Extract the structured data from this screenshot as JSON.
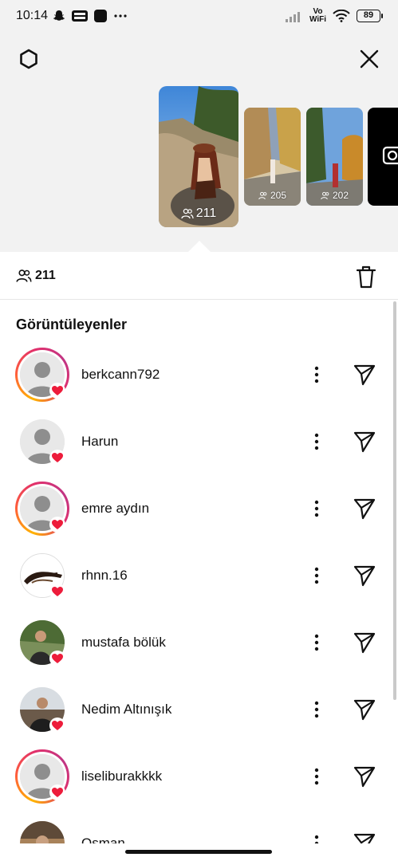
{
  "status_bar": {
    "time": "10:14",
    "left_icons": [
      "snapchat-icon",
      "temu-icon",
      "app-icon",
      "more-dots-icon"
    ],
    "vowifi_top": "Vo",
    "vowifi_bottom": "WiFi",
    "battery": "89"
  },
  "header": {
    "settings_icon": "gear-icon",
    "close_icon": "close-icon"
  },
  "stories": [
    {
      "count": "211",
      "selected": true
    },
    {
      "count": "205",
      "selected": false
    },
    {
      "count": "202",
      "selected": false
    },
    {
      "icon": "camera-icon",
      "selected": false
    }
  ],
  "summary": {
    "viewer_count": "211",
    "delete_icon": "trash-icon"
  },
  "viewers_title": "Görüntüleyenler",
  "viewers": [
    {
      "username": "berkcann792",
      "ring": true,
      "avatar": "default",
      "liked": true
    },
    {
      "username": "Harun",
      "ring": false,
      "avatar": "default",
      "liked": true
    },
    {
      "username": "emre aydın",
      "ring": true,
      "avatar": "default",
      "liked": true
    },
    {
      "username": "rhnn.16",
      "ring": false,
      "avatar": "logo",
      "liked": true
    },
    {
      "username": "mustafa bölük",
      "ring": false,
      "avatar": "photo",
      "liked": true
    },
    {
      "username": "Nedim Altınışık",
      "ring": false,
      "avatar": "photo2",
      "liked": true
    },
    {
      "username": "liseliburakkkk",
      "ring": true,
      "avatar": "default",
      "liked": true
    },
    {
      "username": "Osman",
      "ring": false,
      "avatar": "photo3",
      "liked": false
    }
  ],
  "colors": {
    "heart": "#ed1c3b",
    "ring_start": "#ffb400",
    "ring_end": "#c13584",
    "top_background": "#f2f2f2"
  }
}
